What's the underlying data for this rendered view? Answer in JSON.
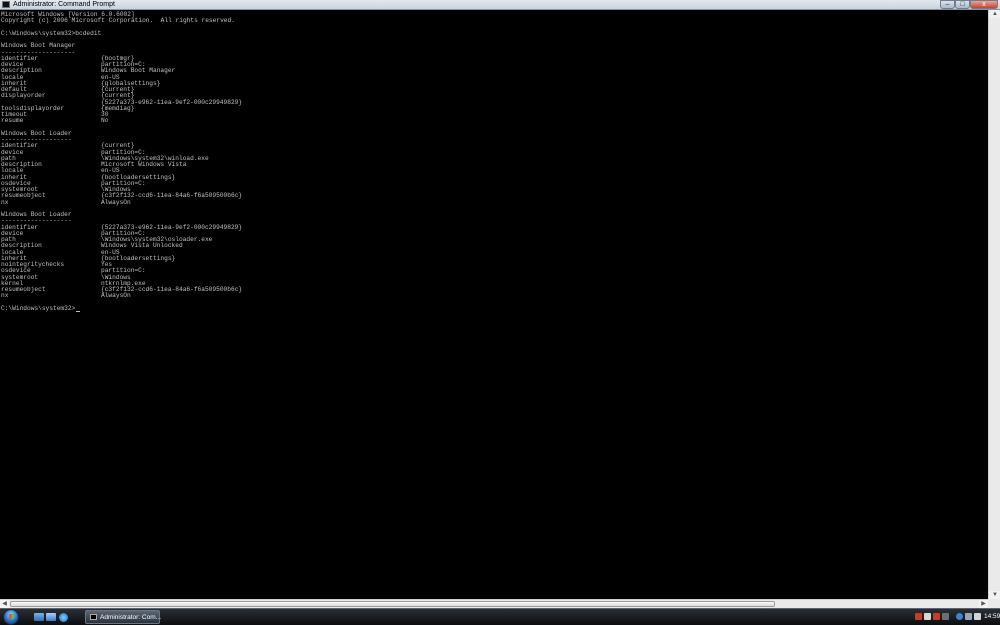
{
  "window": {
    "title": "Administrator: Command Prompt",
    "minimize": "–",
    "maximize": "□",
    "close": "x"
  },
  "console": {
    "lines": [
      {
        "text": "Microsoft Windows [Version 6.0.6002]"
      },
      {
        "text": "Copyright (c) 2006 Microsoft Corporation.  All rights reserved."
      },
      {
        "text": ""
      },
      {
        "text": "C:\\Windows\\system32>bcdedit"
      },
      {
        "text": ""
      },
      {
        "text": "Windows Boot Manager"
      },
      {
        "text": "--------------------"
      },
      {
        "key": "identifier",
        "value": "{bootmgr}"
      },
      {
        "key": "device",
        "value": "partition=C:"
      },
      {
        "key": "description",
        "value": "Windows Boot Manager"
      },
      {
        "key": "locale",
        "value": "en-US"
      },
      {
        "key": "inherit",
        "value": "{globalsettings}"
      },
      {
        "key": "default",
        "value": "{current}"
      },
      {
        "key": "displayorder",
        "value": "{current}"
      },
      {
        "key": "",
        "value": "{5227a373-e962-11ea-9ef2-000c29949829}"
      },
      {
        "key": "toolsdisplayorder",
        "value": "{memdiag}"
      },
      {
        "key": "timeout",
        "value": "30"
      },
      {
        "key": "resume",
        "value": "No"
      },
      {
        "text": ""
      },
      {
        "text": "Windows Boot Loader"
      },
      {
        "text": "-------------------"
      },
      {
        "key": "identifier",
        "value": "{current}"
      },
      {
        "key": "device",
        "value": "partition=C:"
      },
      {
        "key": "path",
        "value": "\\Windows\\system32\\winload.exe"
      },
      {
        "key": "description",
        "value": "Microsoft Windows Vista"
      },
      {
        "key": "locale",
        "value": "en-US"
      },
      {
        "key": "inherit",
        "value": "{bootloadersettings}"
      },
      {
        "key": "osdevice",
        "value": "partition=C:"
      },
      {
        "key": "systemroot",
        "value": "\\Windows"
      },
      {
        "key": "resumeobject",
        "value": "{c3f2f132-ccd6-11ea-84a6-f6a509500b6c}"
      },
      {
        "key": "nx",
        "value": "AlwaysOn"
      },
      {
        "text": ""
      },
      {
        "text": "Windows Boot Loader"
      },
      {
        "text": "-------------------"
      },
      {
        "key": "identifier",
        "value": "{5227a373-e962-11ea-9ef2-000c29949829}"
      },
      {
        "key": "device",
        "value": "partition=C:"
      },
      {
        "key": "path",
        "value": "\\Windows\\system32\\osloader.exe"
      },
      {
        "key": "description",
        "value": "Windows Vista Unlocked"
      },
      {
        "key": "locale",
        "value": "en-US"
      },
      {
        "key": "inherit",
        "value": "{bootloadersettings}"
      },
      {
        "key": "nointegritychecks",
        "value": "Yes"
      },
      {
        "key": "osdevice",
        "value": "partition=C:"
      },
      {
        "key": "systemroot",
        "value": "\\Windows"
      },
      {
        "key": "kernel",
        "value": "ntkrnlmp.exe"
      },
      {
        "key": "resumeobject",
        "value": "{c3f2f132-ccd6-11ea-84a6-f6a509500b6c}"
      },
      {
        "key": "nx",
        "value": "AlwaysOn"
      },
      {
        "text": ""
      }
    ],
    "prompt": "C:\\Windows\\system32>",
    "text_color": "#c0c0c0",
    "background": "#000000"
  },
  "scrollbars": {
    "up_arrow": "▲",
    "down_arrow": "▼",
    "left_arrow": "◀",
    "right_arrow": "▶"
  },
  "taskbar": {
    "task_label": "Administrator: Com...",
    "clock": "14:59"
  }
}
